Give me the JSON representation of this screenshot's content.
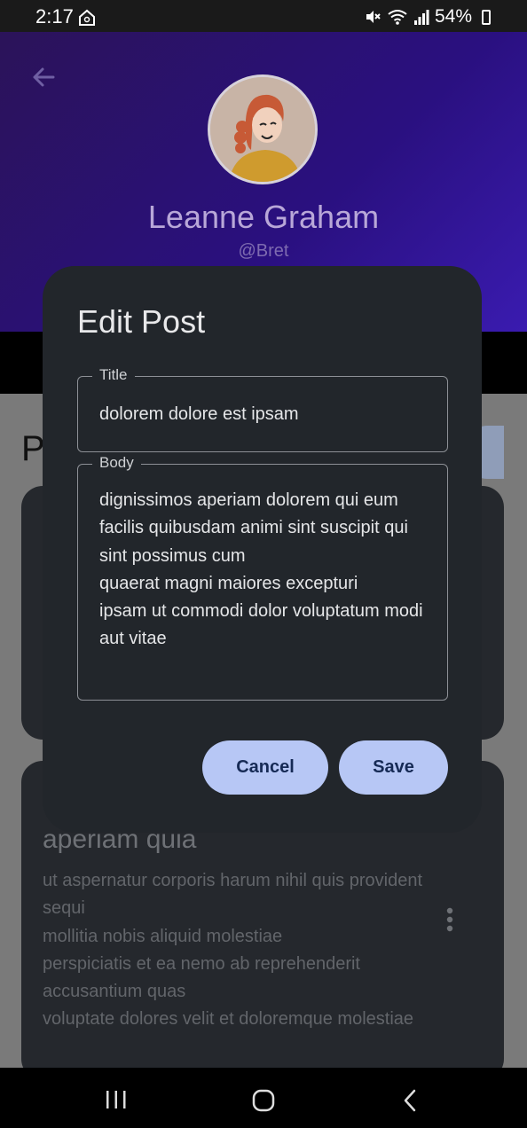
{
  "status_bar": {
    "time": "2:17",
    "battery": "54%"
  },
  "profile": {
    "name": "Leanne Graham",
    "handle": "@Bret"
  },
  "posts": {
    "heading": "P",
    "cards": [
      {
        "title": "aperiam quia",
        "body": "ut aspernatur corporis harum nihil quis provident sequi\nmollitia nobis aliquid molestiae\nperspiciatis et ea nemo ab reprehenderit accusantium quas\nvoluptate dolores velit et doloremque molestiae"
      }
    ]
  },
  "dialog": {
    "title": "Edit Post",
    "fields": {
      "title_label": "Title",
      "title_value": "dolorem dolore est ipsam",
      "body_label": "Body",
      "body_value": "dignissimos aperiam dolorem qui eum\nfacilis quibusdam animi sint suscipit qui sint possimus cum\nquaerat magni maiores excepturi\nipsam ut commodi dolor voluptatum modi aut vitae"
    },
    "cancel_label": "Cancel",
    "save_label": "Save"
  },
  "icons": {
    "back": "arrow-back-icon",
    "more": "more-vert-icon",
    "nav_recent": "recent-apps-icon",
    "nav_home": "home-icon",
    "nav_back": "nav-back-icon"
  },
  "colors": {
    "header_gradient_start": "#2b1359",
    "header_gradient_end": "#3a1bb0",
    "dialog_bg": "#22262b",
    "button_bg": "#b7c7f5",
    "button_text": "#162a55"
  }
}
